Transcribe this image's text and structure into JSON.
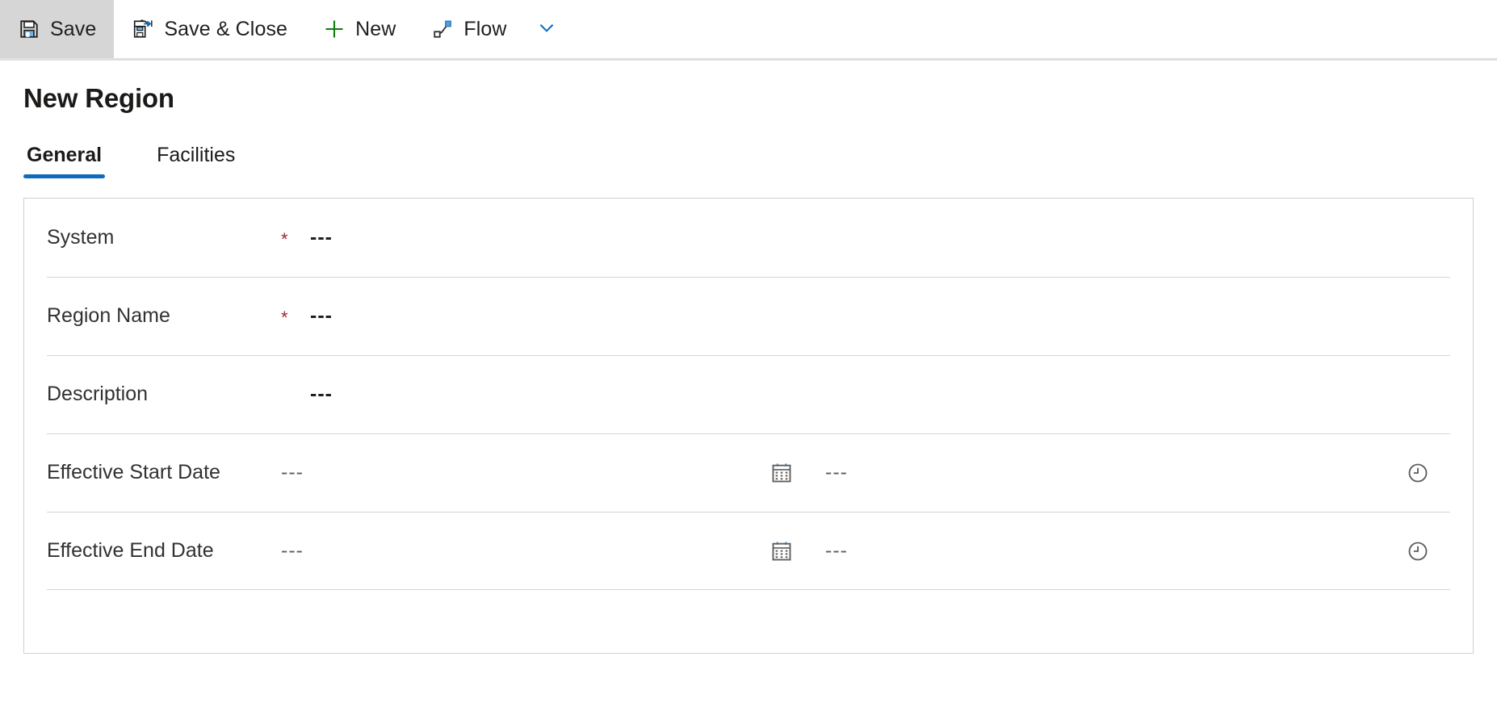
{
  "colors": {
    "accent": "#0f6cbd",
    "required": "#a4262c",
    "icon_blue": "#0f6cbd",
    "icon_green": "#107c10",
    "divider": "#d6d4d2",
    "card_border": "#d2d0ce",
    "active_button_bg": "#d6d6d6"
  },
  "commandbar": {
    "buttons": [
      {
        "label": "Save",
        "icon": "save-icon",
        "active": true
      },
      {
        "label": "Save & Close",
        "icon": "save-and-close-icon",
        "active": false
      },
      {
        "label": "New",
        "icon": "plus-icon",
        "active": false
      },
      {
        "label": "Flow",
        "icon": "flow-icon",
        "active": false
      }
    ],
    "overflow_icon": "chevron-down-icon"
  },
  "page": {
    "title": "New Region"
  },
  "tabs": [
    {
      "label": "General",
      "selected": true
    },
    {
      "label": "Facilities",
      "selected": false
    }
  ],
  "form": {
    "rows": [
      {
        "label": "System",
        "required": true,
        "required_marker": "*",
        "value": "---",
        "type": "text"
      },
      {
        "label": "Region Name",
        "required": true,
        "required_marker": "*",
        "value": "---",
        "type": "text"
      },
      {
        "label": "Description",
        "required": false,
        "required_marker": "",
        "value": "---",
        "type": "text"
      },
      {
        "label": "Effective Start Date",
        "required": false,
        "required_marker": "",
        "value": "---",
        "time_value": "---",
        "date_icon": "calendar-icon",
        "time_icon": "clock-icon",
        "type": "datetime"
      },
      {
        "label": "Effective End Date",
        "required": false,
        "required_marker": "",
        "value": "---",
        "time_value": "---",
        "date_icon": "calendar-icon",
        "time_icon": "clock-icon",
        "type": "datetime"
      }
    ]
  }
}
